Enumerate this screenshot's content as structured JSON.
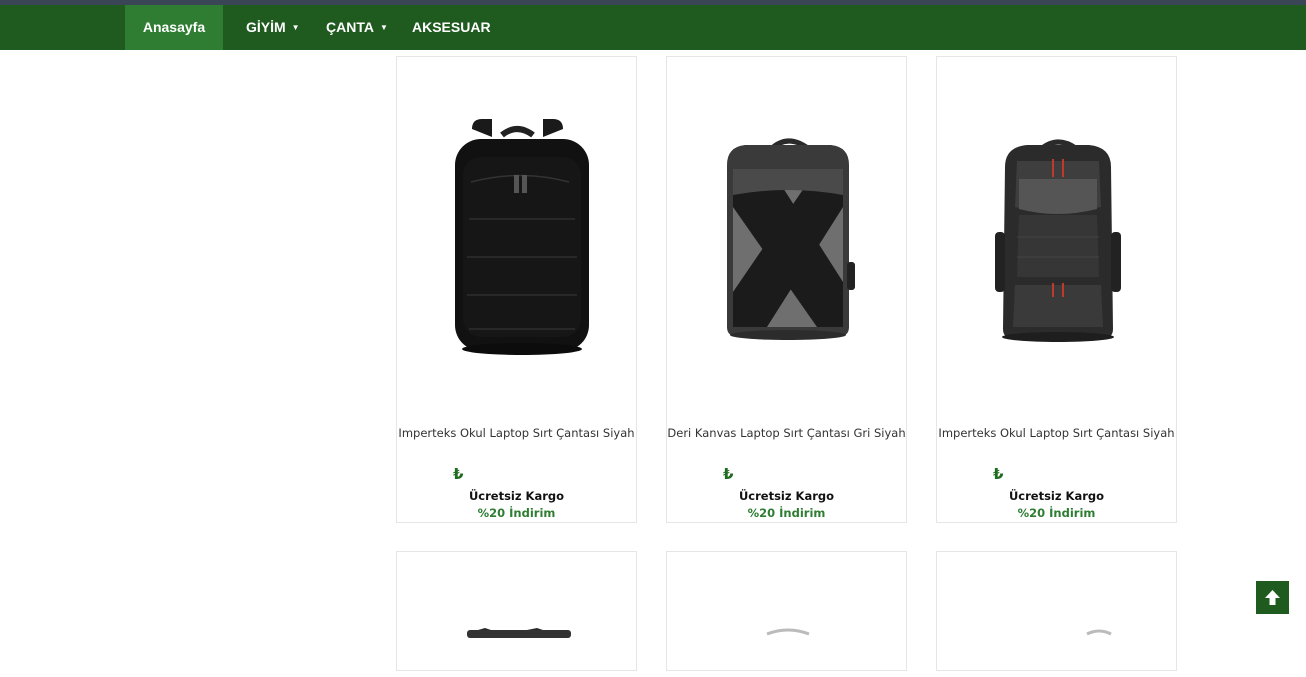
{
  "nav": {
    "items": [
      {
        "label": "Anasayfa"
      },
      {
        "label": "GİYİM"
      },
      {
        "label": "ÇANTA"
      },
      {
        "label": "AKSESUAR"
      }
    ],
    "caret": "▼"
  },
  "products": [
    {
      "title": "Imperteks Okul Laptop Sırt Çantası Siyah",
      "currency": "₺",
      "shipping": "Ücretsiz Kargo",
      "discount": "%20 İndirim"
    },
    {
      "title": "Deri Kanvas Laptop Sırt Çantası Gri Siyah",
      "currency": "₺",
      "shipping": "Ücretsiz Kargo",
      "discount": "%20 İndirim"
    },
    {
      "title": "Imperteks Okul Laptop Sırt Çantası Siyah",
      "currency": "₺",
      "shipping": "Ücretsiz Kargo",
      "discount": "%20 İndirim"
    }
  ],
  "colors": {
    "nav": "#1f5a1f",
    "active": "#2e7d32",
    "accent": "#2e7d32"
  },
  "icons": {
    "scroll_top": "arrow-up-icon",
    "currency": "lira-icon"
  }
}
